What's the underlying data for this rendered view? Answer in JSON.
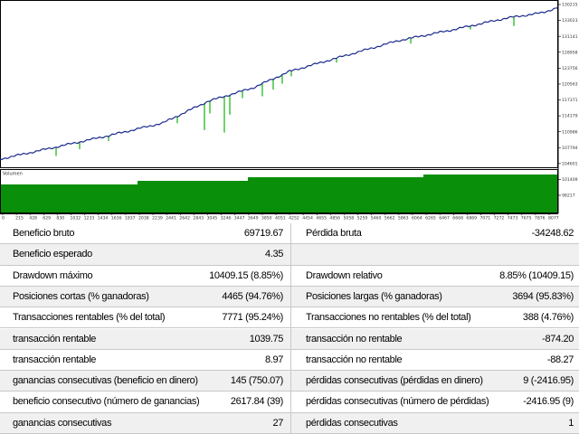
{
  "chart": {
    "colors": {
      "equity": "#1a2a8c",
      "drawdown_spikes": "#22b81c",
      "volume": "#0a8f0a",
      "grid_border": "#000000"
    },
    "price_axis": [
      "130215",
      "133023",
      "131141",
      "128958",
      "123756",
      "120563",
      "117371",
      "114179",
      "110986",
      "107794",
      "104601",
      "101409",
      "98217"
    ],
    "volume_label": "Volumen",
    "x_axis": [
      "0",
      "215",
      "428",
      "629",
      "830",
      "1032",
      "1233",
      "1434",
      "1636",
      "1837",
      "2038",
      "2239",
      "2441",
      "2642",
      "2843",
      "3045",
      "3246",
      "3447",
      "3649",
      "3850",
      "4051",
      "4252",
      "4454",
      "4655",
      "4856",
      "5058",
      "5259",
      "5460",
      "5662",
      "5863",
      "6064",
      "6265",
      "6467",
      "6668",
      "6869",
      "7071",
      "7272",
      "7473",
      "7675",
      "7876",
      "8077"
    ]
  },
  "stats": {
    "rows": [
      {
        "l1": "Beneficio bruto",
        "v1": "69719.67",
        "l2": "Pérdida bruta",
        "v2": "-34248.62"
      },
      {
        "l1": "Beneficio esperado",
        "v1": "4.35",
        "l2": "",
        "v2": ""
      },
      {
        "l1": "Drawdown máximo",
        "v1": "10409.15 (8.85%)",
        "l2": "Drawdown relativo",
        "v2": "8.85% (10409.15)"
      },
      {
        "l1": "Posiciones cortas (% ganadoras)",
        "v1": "4465 (94.76%)",
        "l2": "Posiciones largas (% ganadoras)",
        "v2": "3694 (95.83%)"
      },
      {
        "l1": "Transacciones rentables (% del total)",
        "v1": "7771 (95.24%)",
        "l2": "Transacciones no rentables (% del total)",
        "v2": "388 (4.76%)"
      },
      {
        "l1": "transacción rentable",
        "v1": "1039.75",
        "l2": "transacción no rentable",
        "v2": "-874.20"
      },
      {
        "l1": "transacción rentable",
        "v1": "8.97",
        "l2": "transacción no rentable",
        "v2": "-88.27"
      },
      {
        "l1": "ganancias consecutivas (beneficio en dinero)",
        "v1": "145 (750.07)",
        "l2": "pérdidas consecutivas (pérdidas en dinero)",
        "v2": "9 (-2416.95)"
      },
      {
        "l1": "beneficio consecutivo (número de ganancias)",
        "v1": "2617.84 (39)",
        "l2": "pérdidas consecutivas (número de pérdidas)",
        "v2": "-2416.95 (9)"
      },
      {
        "l1": "ganancias consecutivas",
        "v1": "27",
        "l2": "pérdidas consecutivas",
        "v2": "1"
      }
    ]
  }
}
